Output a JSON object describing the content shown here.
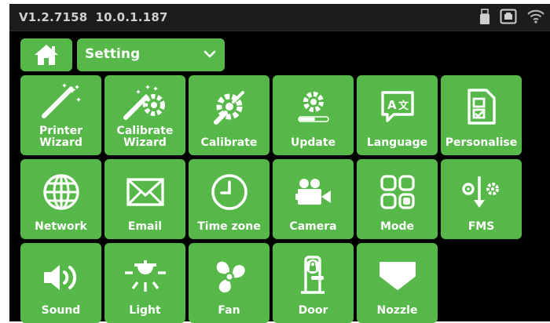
{
  "status": {
    "version": "V1.2.7158",
    "ip": "10.0.1.187"
  },
  "header": {
    "home_icon": "home-icon",
    "dropdown_label": "Setting"
  },
  "tiles": [
    {
      "label": "Printer\nWizard",
      "icon": "magic-wand-icon"
    },
    {
      "label": "Calibrate\nWizard",
      "icon": "calibrate-wizard-icon"
    },
    {
      "label": "Calibrate",
      "icon": "calibrate-icon"
    },
    {
      "label": "Update",
      "icon": "update-icon"
    },
    {
      "label": "Language",
      "icon": "language-icon"
    },
    {
      "label": "Personalise",
      "icon": "personalise-icon"
    },
    {
      "label": "Network",
      "icon": "globe-icon"
    },
    {
      "label": "Email",
      "icon": "envelope-icon"
    },
    {
      "label": "Time zone",
      "icon": "clock-icon"
    },
    {
      "label": "Camera",
      "icon": "camera-icon"
    },
    {
      "label": "Mode",
      "icon": "mode-icon"
    },
    {
      "label": "FMS",
      "icon": "fms-icon"
    },
    {
      "label": "Sound",
      "icon": "speaker-icon"
    },
    {
      "label": "Light",
      "icon": "lamp-icon"
    },
    {
      "label": "Fan",
      "icon": "fan-icon"
    },
    {
      "label": "Door",
      "icon": "door-lock-icon"
    },
    {
      "label": "Nozzle",
      "icon": "nozzle-icon"
    }
  ],
  "colors": {
    "tile": "#56b848",
    "status_bar": "#1c1c1c",
    "background": "#000000"
  }
}
